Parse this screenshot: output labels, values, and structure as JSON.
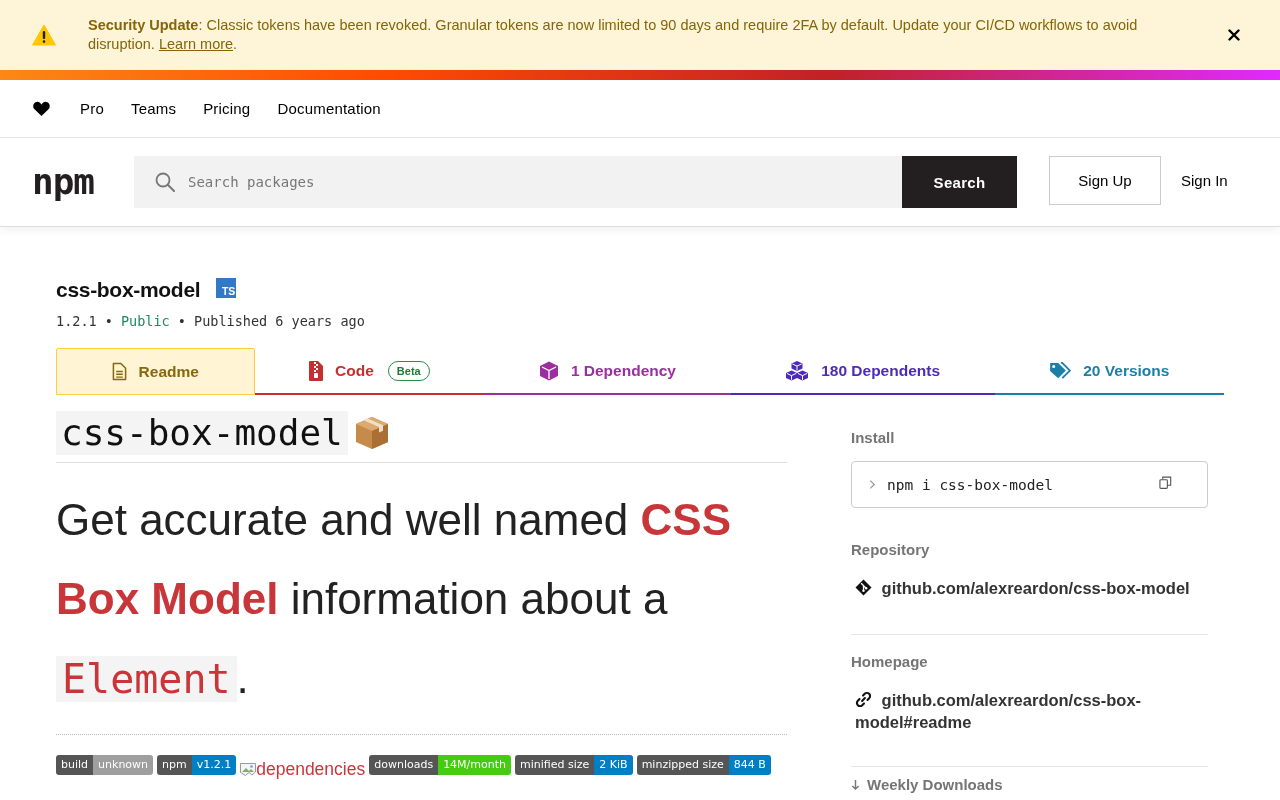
{
  "banner": {
    "message": "**Security Update**: Classic tokens have been revoked. Granular tokens are now limited to 90 days and require 2FA by default. Update your CI/CD workflows to avoid disruption.",
    "link": "Learn more",
    "after_link": "."
  },
  "nav": {
    "links": [
      "Pro",
      "Teams",
      "Pricing",
      "Documentation"
    ]
  },
  "header": {
    "logo": "npm",
    "search": {
      "placeholder": "Search packages",
      "button": "Search"
    },
    "sign_up": "Sign Up",
    "sign_in": "Sign In"
  },
  "package": {
    "name": "css-box-model",
    "types_badge": "TS",
    "meta": [
      {
        "text": "1.2.1",
        "kind": "text"
      },
      {
        "text": "•",
        "kind": "separator"
      },
      {
        "text": "Public",
        "kind": "visibility"
      },
      {
        "text": "•",
        "kind": "separator"
      },
      {
        "text": "Published 6 years ago",
        "kind": "text"
      }
    ]
  },
  "tabs": [
    {
      "label": "Readme",
      "kind": "readme",
      "selected": true,
      "color": "#86690c"
    },
    {
      "label": "Code",
      "kind": "code",
      "badge": "Beta",
      "selected": false,
      "color": "#c4302f"
    },
    {
      "label": "1 Dependency",
      "kind": "dependencies",
      "selected": false,
      "color": "#9b2fa0"
    },
    {
      "label": "180 Dependents",
      "kind": "dependents",
      "selected": false,
      "color": "#4d2bb8"
    },
    {
      "label": "20 Versions",
      "kind": "versions",
      "selected": false,
      "color": "#1b7fa8"
    }
  ],
  "readme": {
    "heading": "css-box-model",
    "intro": [
      {
        "text": "Get accurate and well named ",
        "kind": "text"
      },
      {
        "text": "CSS Box Model",
        "kind": "strong"
      },
      {
        "text": " information about a ",
        "kind": "text"
      },
      {
        "text": "Element",
        "kind": "code"
      },
      {
        "text": ".",
        "kind": "text"
      }
    ],
    "badges": [
      {
        "kind": "shield",
        "label": "build",
        "value": "unknown",
        "color": "#9f9f9f"
      },
      {
        "kind": "shield",
        "label": "npm",
        "value": "v1.2.1",
        "color": "#007ec6"
      },
      {
        "kind": "broken-image",
        "alt": "dependencies"
      },
      {
        "kind": "shield",
        "label": "downloads",
        "value": "14M/month",
        "color": "#44cc11"
      },
      {
        "kind": "shield",
        "label": "minified size",
        "value": "2 KiB",
        "color": "#007ec6"
      },
      {
        "kind": "shield",
        "label": "minzipped size",
        "value": "844 B",
        "color": "#007ec6"
      }
    ]
  },
  "sidebar": {
    "sections": [
      {
        "kind": "install",
        "label": "Install",
        "command": "npm i css-box-model"
      },
      {
        "kind": "repository",
        "label": "Repository",
        "link": "github.com/alexreardon/css-box-model"
      },
      {
        "kind": "homepage",
        "label": "Homepage",
        "link": "github.com/alexreardon/css-box-model#readme"
      },
      {
        "kind": "downloads",
        "label": "Weekly Downloads"
      }
    ]
  }
}
